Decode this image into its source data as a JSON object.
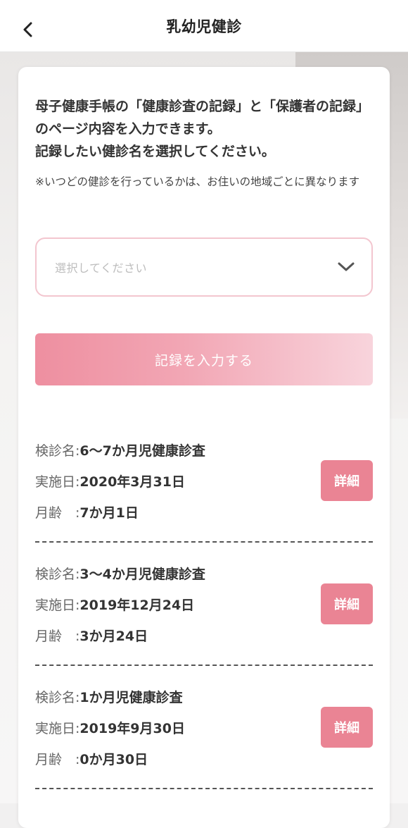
{
  "header": {
    "title": "乳幼児健診"
  },
  "intro": {
    "line1": "母子健康手帳の「健康診査の記録」と「保護者の記録」のページ内容を入力できます。",
    "line2": "記録したい健診名を選択してください。",
    "note": "※いつどの健診を行っているかは、お住いの地域ごとに異なります"
  },
  "select": {
    "placeholder": "選択してください"
  },
  "submit": {
    "label": "記録を入力する"
  },
  "labels": {
    "name": "検診名:",
    "date": "実施日:",
    "age": "月齢　:",
    "detail": "詳細"
  },
  "records": [
    {
      "name": "6〜7か月児健康診査",
      "date": "2020年3月31日",
      "age": "7か月1日"
    },
    {
      "name": "3〜4か月児健康診査",
      "date": "2019年12月24日",
      "age": "3か月24日"
    },
    {
      "name": "1か月児健康診査",
      "date": "2019年9月30日",
      "age": "0か月30日"
    }
  ],
  "colors": {
    "accent": "#ea8494",
    "select_border": "#f3c6cf"
  },
  "icons": {
    "back": "chevron-left-icon",
    "dropdown": "chevron-down-icon"
  }
}
